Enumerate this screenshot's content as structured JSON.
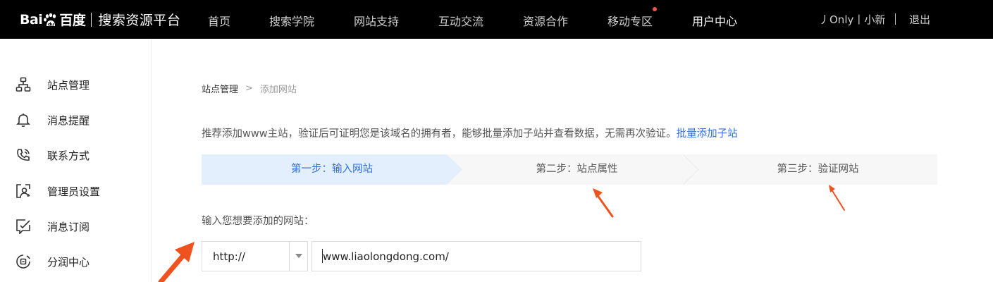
{
  "header": {
    "logo_text_left": "Bai",
    "logo_text_right": "百度",
    "platform_name": "搜索资源平台",
    "nav": [
      {
        "label": "首页"
      },
      {
        "label": "搜索学院"
      },
      {
        "label": "网站支持"
      },
      {
        "label": "互动交流"
      },
      {
        "label": "资源合作"
      },
      {
        "label": "移动专区"
      },
      {
        "label": "用户中心"
      }
    ],
    "user_name": "丿Only丨小新",
    "logout_label": "退出",
    "colors": {
      "background": "#000000",
      "new_dot": "#f5504a"
    }
  },
  "sidebar": {
    "items": [
      {
        "label": "站点管理",
        "icon": "sitemap-icon"
      },
      {
        "label": "消息提醒",
        "icon": "bell-icon"
      },
      {
        "label": "联系方式",
        "icon": "phone-icon"
      },
      {
        "label": "管理员设置",
        "icon": "admin-user-icon"
      },
      {
        "label": "消息订阅",
        "icon": "subscribe-check-icon"
      },
      {
        "label": "分润中心",
        "icon": "revenue-icon"
      }
    ]
  },
  "main": {
    "breadcrumb": {
      "parent": "站点管理",
      "separator": ">",
      "current": "添加网站"
    },
    "tip_text": "推荐添加www主站，验证后可证明您是该域名的拥有者，能够批量添加子站并查看数据，无需再次验证。",
    "tip_link": "批量添加子站",
    "steps": [
      {
        "label": "第一步：输入网站",
        "active": true
      },
      {
        "label": "第二步：站点属性",
        "active": false
      },
      {
        "label": "第三步：验证网站",
        "active": false
      }
    ],
    "field_label": "输入您想要添加的网站：",
    "protocol_select": {
      "value": "http://"
    },
    "url_input": {
      "value": "www.liaolongdong.com/"
    },
    "colors": {
      "accent": "#2f6fdc",
      "active_step_bg": "#e3effd",
      "annotation_arrow": "#f0521f"
    }
  }
}
